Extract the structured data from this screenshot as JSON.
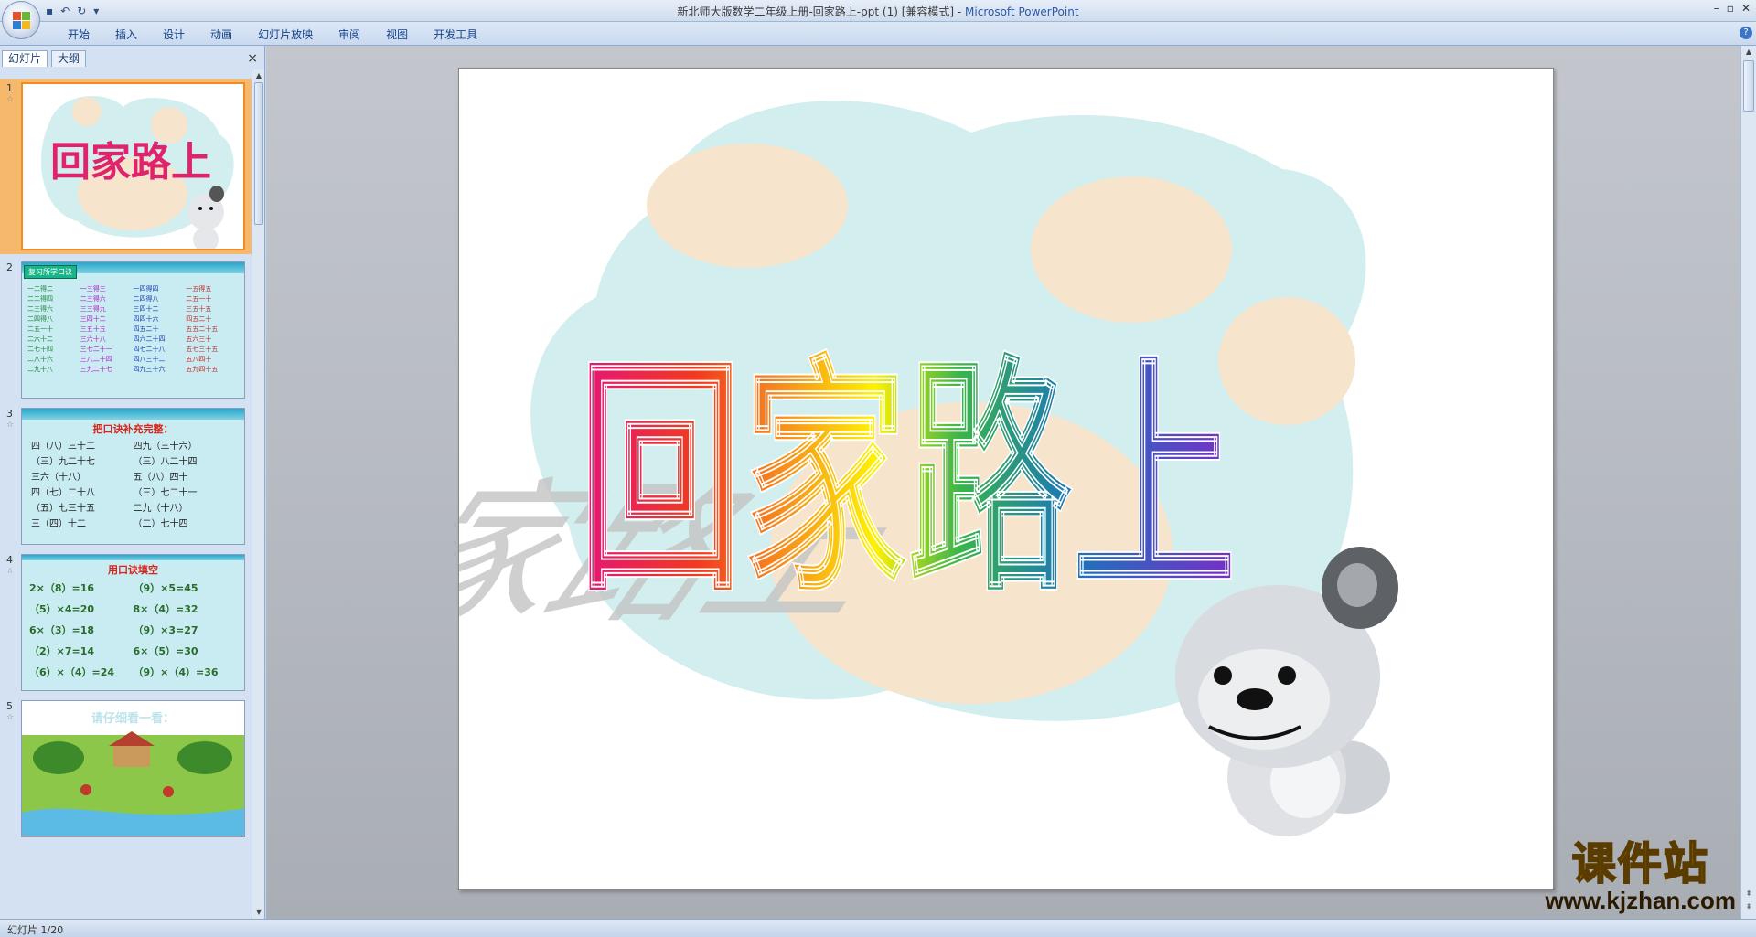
{
  "window": {
    "title": "新北师大版数学二年级上册-回家路上-ppt (1) [兼容模式] - ",
    "app_name": "Microsoft PowerPoint",
    "undo_icon": "undo-icon",
    "redo_icon": "redo-icon",
    "save_icon": "save-icon"
  },
  "ribbon": {
    "tabs": [
      "开始",
      "插入",
      "设计",
      "动画",
      "幻灯片放映",
      "审阅",
      "视图",
      "开发工具"
    ]
  },
  "panel": {
    "tabs": [
      "幻灯片",
      "大纲"
    ],
    "close": "×"
  },
  "slides": [
    {
      "number": "1",
      "title": "回家路上"
    },
    {
      "number": "2",
      "header": "复习所学口诀",
      "rows": [
        [
          "一二得二",
          "一三得三",
          "一四得四",
          "一五得五"
        ],
        [
          "二二得四",
          "二三得六",
          "二四得八",
          "二五一十"
        ],
        [
          "二三得六",
          "三三得九",
          "三四十二",
          "三五十五"
        ],
        [
          "二四得八",
          "三四十二",
          "四四十六",
          "四五二十"
        ],
        [
          "二五一十",
          "三五十五",
          "四五二十",
          "五五二十五"
        ],
        [
          "二六十二",
          "三六十八",
          "四六二十四",
          "五六三十"
        ],
        [
          "二七十四",
          "三七二十一",
          "四七二十八",
          "五七三十五"
        ],
        [
          "二八十六",
          "三八二十四",
          "四八三十二",
          "五八四十"
        ],
        [
          "二九十八",
          "三九二十七",
          "四九三十六",
          "五九四十五"
        ]
      ]
    },
    {
      "number": "3",
      "title": "把口诀补充完整：",
      "items": [
        "四（八）三十二",
        "四九（三十六）",
        "（三）九二十七",
        "（三）八二十四",
        "三六（十八）",
        "五（八）四十",
        "四（七）二十八",
        "（三）七二十一",
        "（五）七三十五",
        "二九（十八）",
        "三（四）十二",
        "（二）七十四"
      ]
    },
    {
      "number": "4",
      "title": "用口诀填空",
      "items": [
        "2×（8）=16",
        "（9）×5=45",
        "（5）×4=20",
        "8×（4）=32",
        "6×（3）=18",
        "（9）×3=27",
        "（2）×7=14",
        "6×（5）=30",
        "（6）×（4）=24",
        "（9）×（4）=36"
      ]
    },
    {
      "number": "5",
      "title": "请仔细看一看："
    }
  ],
  "main_slide": {
    "title": "回家路上"
  },
  "watermark": {
    "text": "课件站",
    "url": "www.kjzhan.com"
  },
  "status": {
    "slide_indicator": "幻灯片 1/20"
  },
  "colors": {
    "accent": "#15428b",
    "selection": "#f6b86c"
  }
}
